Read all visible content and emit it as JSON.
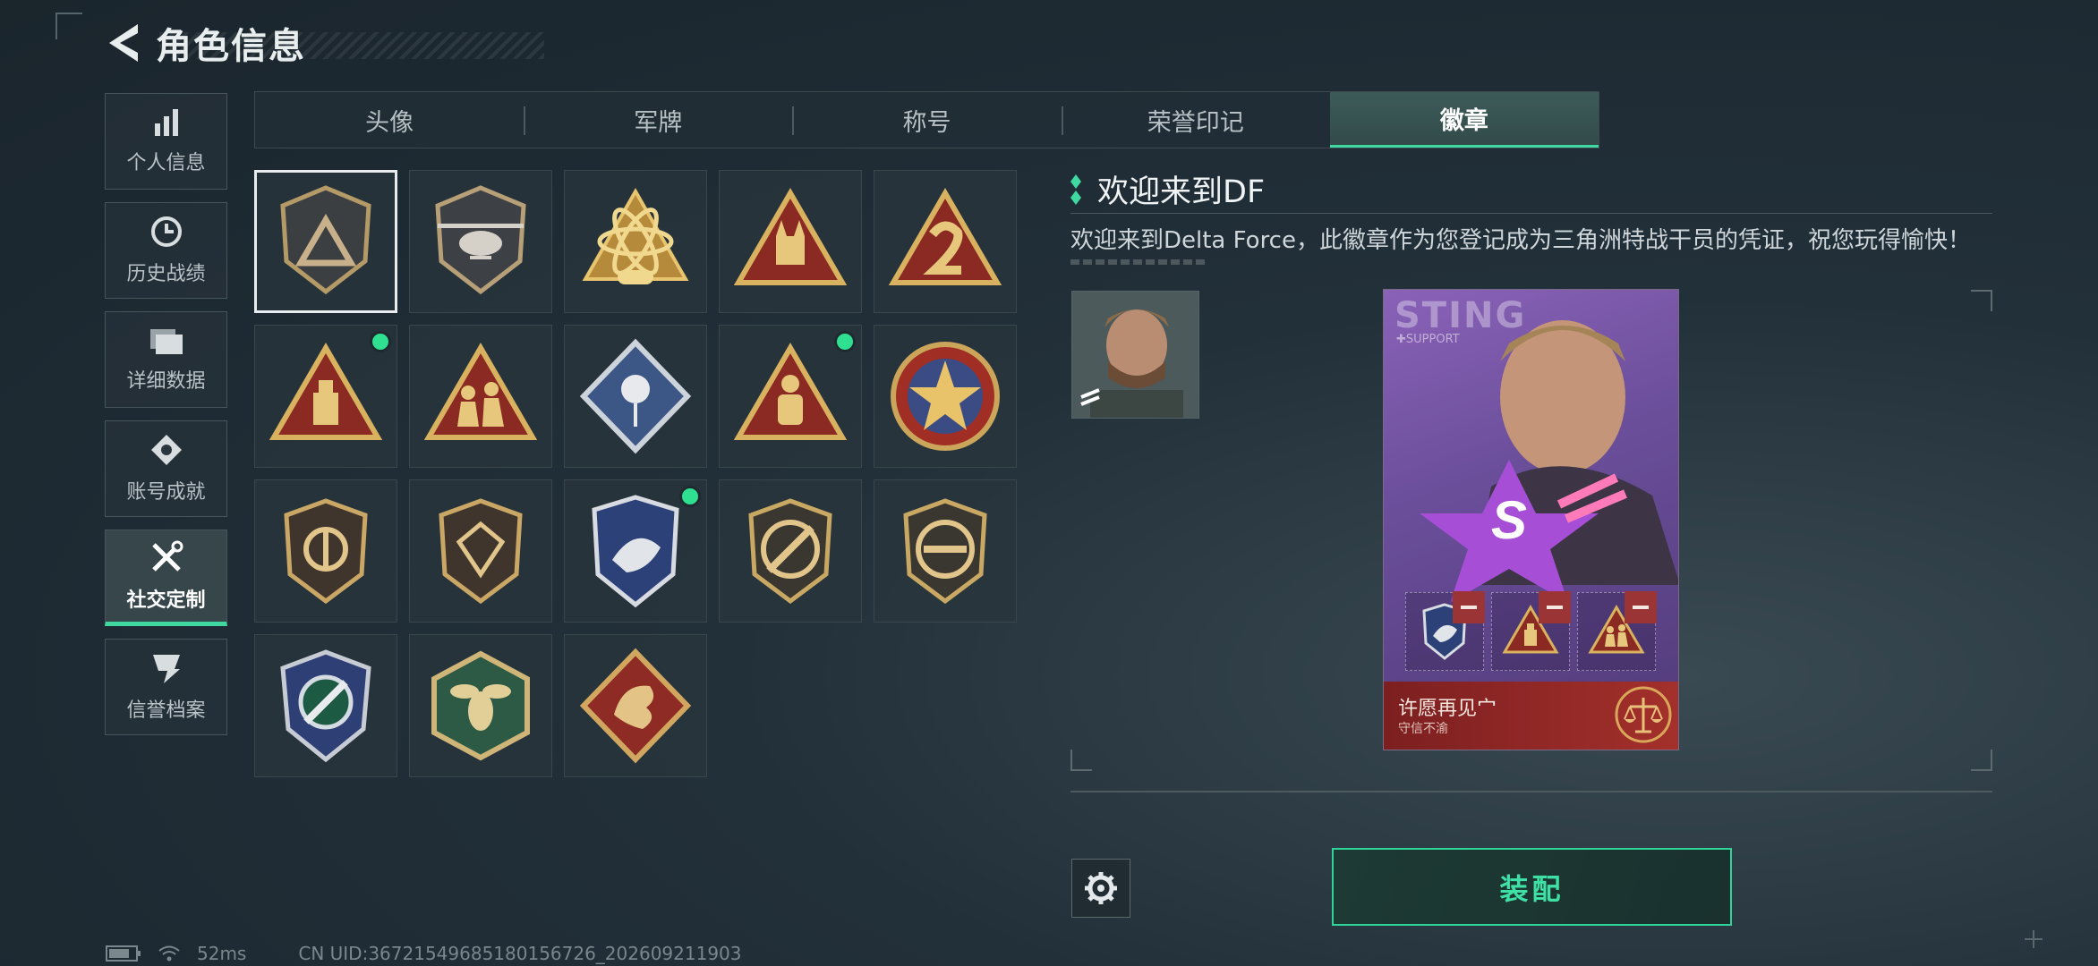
{
  "header": {
    "title": "角色信息"
  },
  "sidebar": {
    "items": [
      {
        "label": "个人信息",
        "icon": "bar-chart-icon"
      },
      {
        "label": "历史战绩",
        "icon": "history-icon"
      },
      {
        "label": "详细数据",
        "icon": "folder-icon"
      },
      {
        "label": "账号成就",
        "icon": "achievement-icon"
      },
      {
        "label": "社交定制",
        "icon": "tools-icon",
        "active": true
      },
      {
        "label": "信誉档案",
        "icon": "credit-icon"
      }
    ]
  },
  "tabs": [
    {
      "label": "头像"
    },
    {
      "label": "军牌"
    },
    {
      "label": "称号"
    },
    {
      "label": "荣誉印记"
    },
    {
      "label": "徽章",
      "active": true
    }
  ],
  "badges": [
    {
      "name": "delta-shield",
      "selected": true,
      "new": false
    },
    {
      "name": "helicopter-shield",
      "selected": false,
      "new": false
    },
    {
      "name": "gold-atom-s10",
      "selected": false,
      "new": false
    },
    {
      "name": "rock-hand-triangle",
      "selected": false,
      "new": false
    },
    {
      "name": "number-2-triangle",
      "selected": false,
      "new": false
    },
    {
      "name": "usb-triangle",
      "selected": false,
      "new": true
    },
    {
      "name": "squad-triangle",
      "selected": false,
      "new": false
    },
    {
      "name": "rose-diamond",
      "selected": false,
      "new": false
    },
    {
      "name": "hazmat-triangle",
      "selected": false,
      "new": true
    },
    {
      "name": "star-circle",
      "selected": false,
      "new": false
    },
    {
      "name": "arrow-circle-shield",
      "selected": false,
      "new": false
    },
    {
      "name": "gem-shield",
      "selected": false,
      "new": false
    },
    {
      "name": "eagle-shield",
      "selected": false,
      "new": true
    },
    {
      "name": "rifle-no-shield",
      "selected": false,
      "new": false
    },
    {
      "name": "smg-no-shield",
      "selected": false,
      "new": false
    },
    {
      "name": "crosshair-blade",
      "selected": false,
      "new": false
    },
    {
      "name": "wasp-hexagon",
      "selected": false,
      "new": false
    },
    {
      "name": "dragon-diamond",
      "selected": false,
      "new": false
    }
  ],
  "detail": {
    "title": "欢迎来到DF",
    "description": "欢迎来到Delta Force，此徽章作为您登记成为三角洲特战干员的凭证，祝您玩得愉快！"
  },
  "card": {
    "code": "STING",
    "code_sub": "✚SUPPORT",
    "name": "许愿再见宀",
    "subtitle": "守信不渝"
  },
  "actions": {
    "equip": "装配"
  },
  "status": {
    "ping": "52ms",
    "uid": "CN UID:36721549685180156726_202609211903"
  },
  "colors": {
    "accent": "#3fd8a0",
    "new_dot": "#2ee08f",
    "gold": "#c9a24a",
    "red": "#8c2a22"
  }
}
